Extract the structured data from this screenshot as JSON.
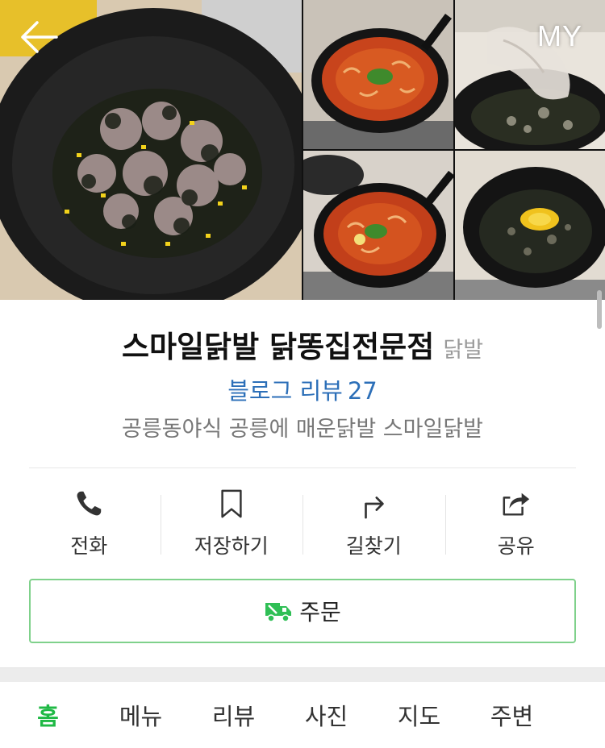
{
  "header": {
    "back_icon": "arrow-left-icon",
    "my_label": "MY"
  },
  "place": {
    "name": "스마일닭발 닭똥집전문점",
    "category": "닭발",
    "blog_review_label": "블로그 리뷰",
    "blog_review_count": "27",
    "tagline": "공릉동야식 공릉에 매운닭발 스마일닭발"
  },
  "actions": [
    {
      "label": "전화",
      "icon": "phone-icon"
    },
    {
      "label": "저장하기",
      "icon": "bookmark-icon"
    },
    {
      "label": "길찾기",
      "icon": "directions-icon"
    },
    {
      "label": "공유",
      "icon": "share-icon"
    }
  ],
  "order": {
    "label": "주문",
    "icon": "delivery-truck-icon"
  },
  "tabs": [
    {
      "label": "홈",
      "active": true
    },
    {
      "label": "메뉴"
    },
    {
      "label": "리뷰"
    },
    {
      "label": "사진"
    },
    {
      "label": "지도"
    },
    {
      "label": "주변"
    }
  ],
  "colors": {
    "accent_green": "#1fb945",
    "order_border": "#7fd18b",
    "link_blue": "#2c6fb8"
  }
}
